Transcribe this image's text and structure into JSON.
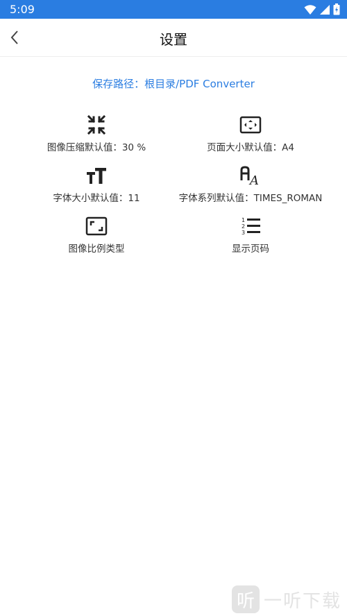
{
  "status": {
    "time": "5:09"
  },
  "header": {
    "title": "设置",
    "back_icon": "chevron-left-icon"
  },
  "save_path": "保存路径：根目录/PDF Converter",
  "settings": [
    {
      "icon": "compress-icon",
      "label": "图像压缩默认值：30 %"
    },
    {
      "icon": "page-size-icon",
      "label": "页面大小默认值：A4"
    },
    {
      "icon": "font-size-icon",
      "label": "字体大小默认值：11"
    },
    {
      "icon": "font-family-icon",
      "label": "字体系列默认值：TIMES_ROMAN"
    },
    {
      "icon": "aspect-ratio-icon",
      "label": "图像比例类型"
    },
    {
      "icon": "numbered-list-icon",
      "label": "显示页码"
    }
  ],
  "watermark": {
    "glyph": "听",
    "text": "一听下载"
  },
  "colors": {
    "accent": "#2a7de1"
  }
}
